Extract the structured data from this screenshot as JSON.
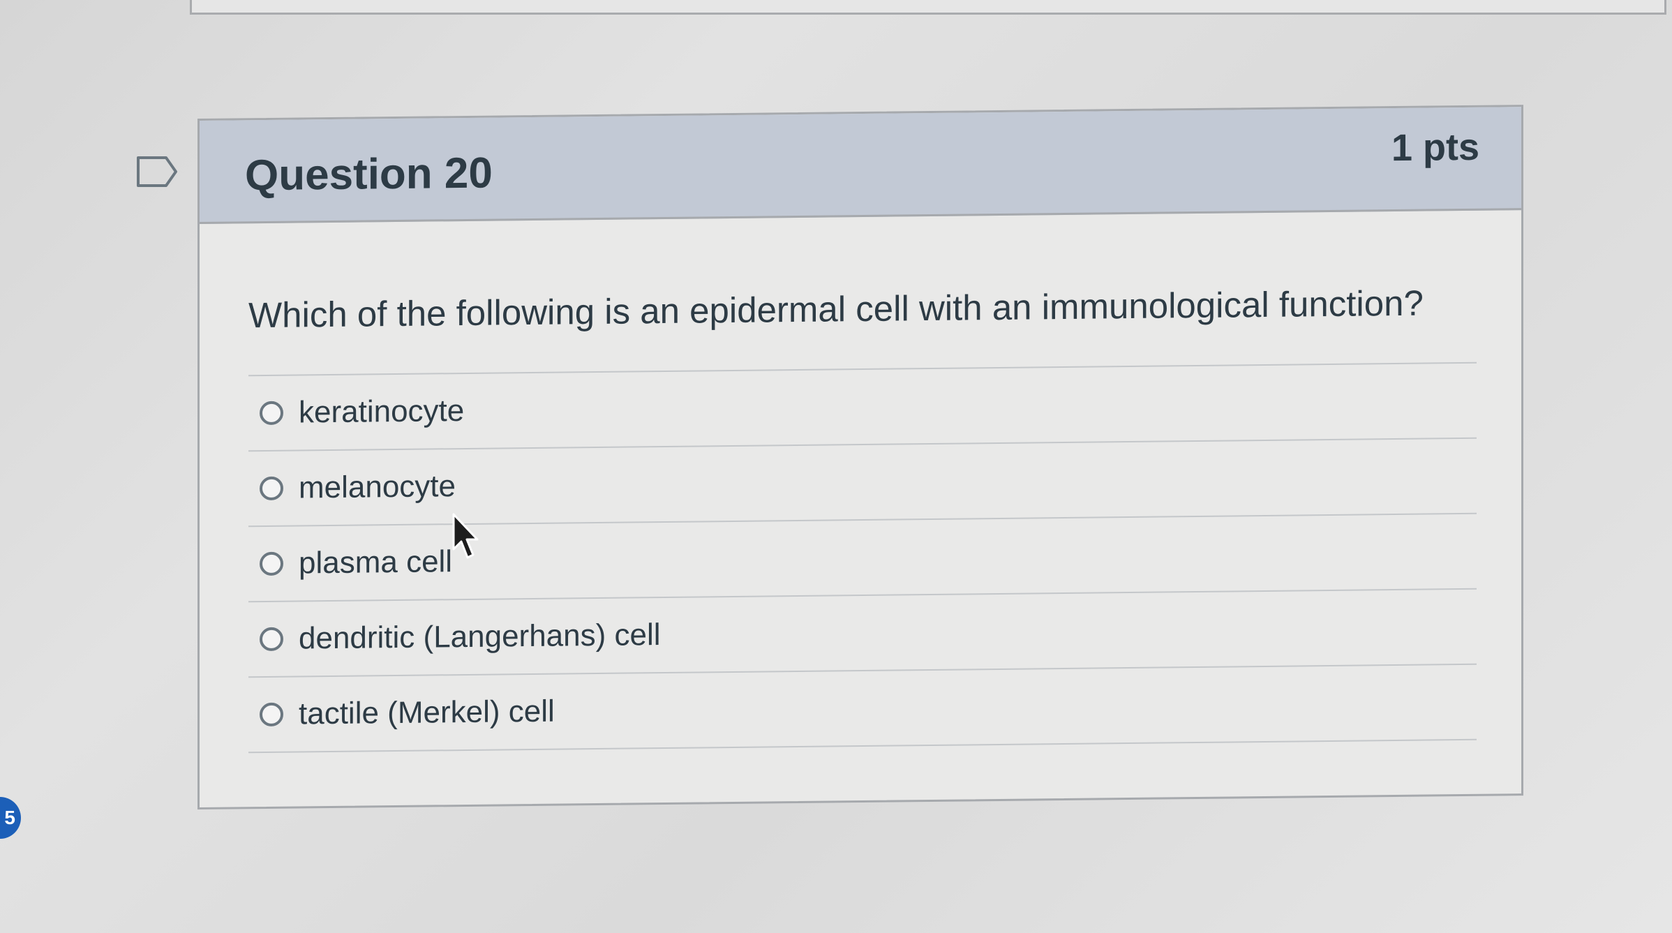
{
  "question": {
    "title": "Question 20",
    "points": "1 pts",
    "text": "Which of the following is an epidermal cell with an immunological function?",
    "answers": [
      {
        "label": "keratinocyte"
      },
      {
        "label": "melanocyte"
      },
      {
        "label": "plasma cell"
      },
      {
        "label": "dendritic (Langerhans) cell"
      },
      {
        "label": "tactile (Merkel) cell"
      }
    ]
  },
  "badge": {
    "text": "5"
  },
  "colors": {
    "header_bg": "#c2c9d5",
    "card_bg": "#e9e9e8",
    "text": "#2d3b45",
    "border": "#a6a9ad",
    "badge": "#1c5fb8"
  },
  "icons": {
    "flag": "flag-question-icon",
    "radio": "radio-button-icon",
    "cursor": "mouse-pointer-icon"
  }
}
